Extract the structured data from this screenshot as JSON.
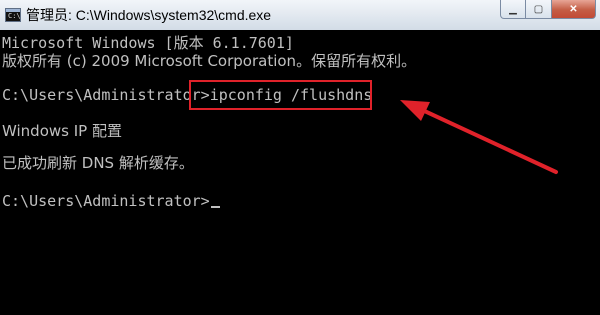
{
  "window": {
    "title": "管理员: C:\\Windows\\system32\\cmd.exe",
    "icon": "cmd-icon",
    "controls": {
      "minimize": "minimize-icon",
      "maximize": "maximize-icon",
      "close": "close-icon"
    }
  },
  "console": {
    "lines": [
      "Microsoft Windows [版本 6.1.7601]",
      "版权所有 (c) 2009 Microsoft Corporation。保留所有权利。",
      "",
      "C:\\Users\\Administrator>",
      "",
      "Windows IP 配置",
      "",
      "已成功刷新 DNS 解析缓存。",
      "",
      "C:\\Users\\Administrator>"
    ],
    "command": "ipconfig /flushdns"
  },
  "annotation": {
    "box_color": "#e0222a",
    "arrow_color": "#e0222a"
  }
}
